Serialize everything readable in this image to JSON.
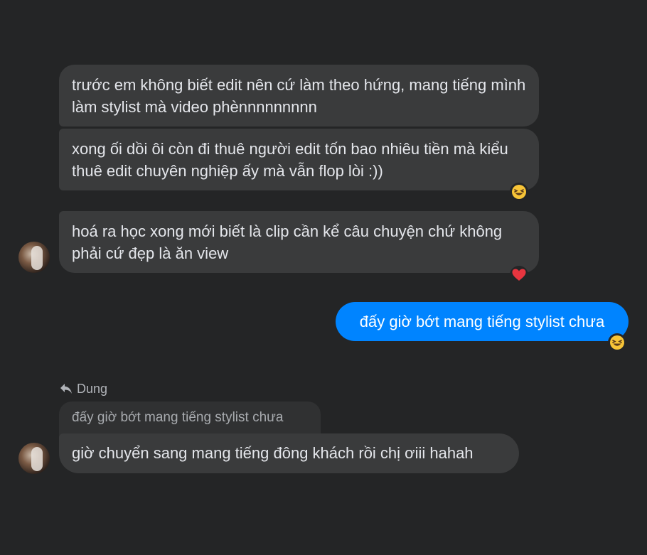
{
  "messages": {
    "m1": "trước em không biết edit nên cứ làm theo hứng, mang tiếng mình làm stylist mà video phènnnnnnnnn",
    "m2": "xong ối dồi ôi còn đi thuê người edit tốn bao nhiêu tiền mà kiểu thuê edit chuyên nghiệp ấy mà vẫn flop lòi :))",
    "m3": "hoá ra học xong mới biết là clip cần kể câu chuyện chứ không phải cứ đẹp là ăn view",
    "outgoing": "đấy giờ bớt mang tiếng stylist chưa",
    "reply_to_name": "Dung",
    "quoted": "đấy giờ bớt mang tiếng stylist chưa",
    "m4": "giờ chuyển sang mang tiếng đông khách rồi chị ơiii hahah"
  },
  "reactions": {
    "m2": "laughing-emoji",
    "m3": "heart-emoji",
    "outgoing": "laughing-emoji"
  },
  "colors": {
    "background": "#242526",
    "incoming_bubble": "#3a3b3c",
    "outgoing_bubble": "#0084ff",
    "text": "#e4e6eb"
  }
}
